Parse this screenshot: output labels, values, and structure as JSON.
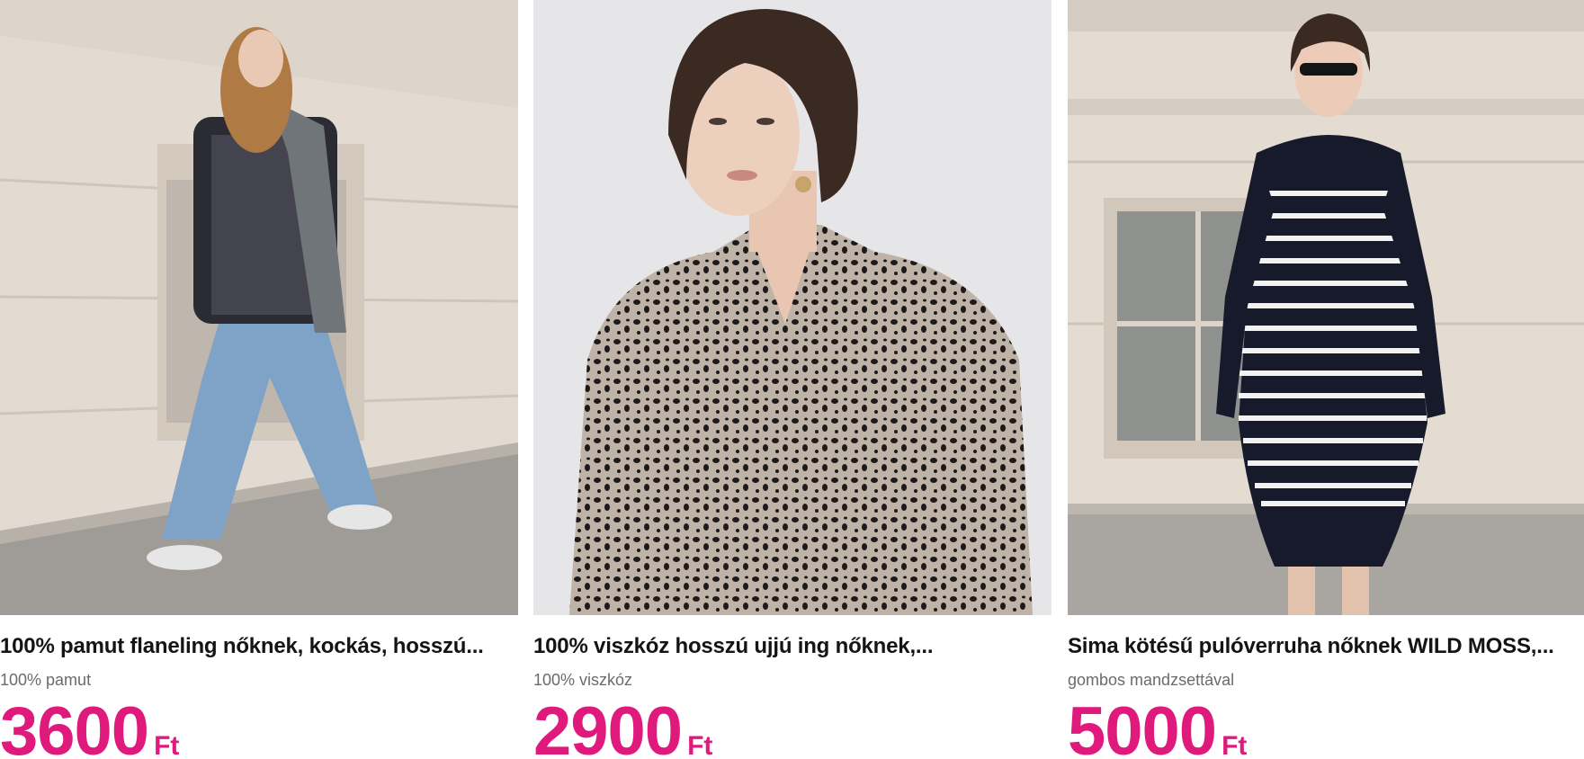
{
  "colors": {
    "price": "#e0197d",
    "title": "#141414",
    "subtitle": "#6b6b6b"
  },
  "products": [
    {
      "title": "100% pamut flaneling nőknek, kockás, hosszú...",
      "subtitle": "100% pamut",
      "price": "3600",
      "currency": "Ft",
      "image": "photo-woman-plaid-shirt-jeans"
    },
    {
      "title": "100% viszkóz hosszú ujjú ing nőknek,...",
      "subtitle": "100% viszkóz",
      "price": "2900",
      "currency": "Ft",
      "image": "photo-woman-leopard-print-shirt"
    },
    {
      "title": "Sima kötésű pulóverruha nőknek WILD MOSS,...",
      "subtitle": "gombos mandzsettával",
      "price": "5000",
      "currency": "Ft",
      "image": "photo-woman-striped-knit-dress"
    }
  ]
}
